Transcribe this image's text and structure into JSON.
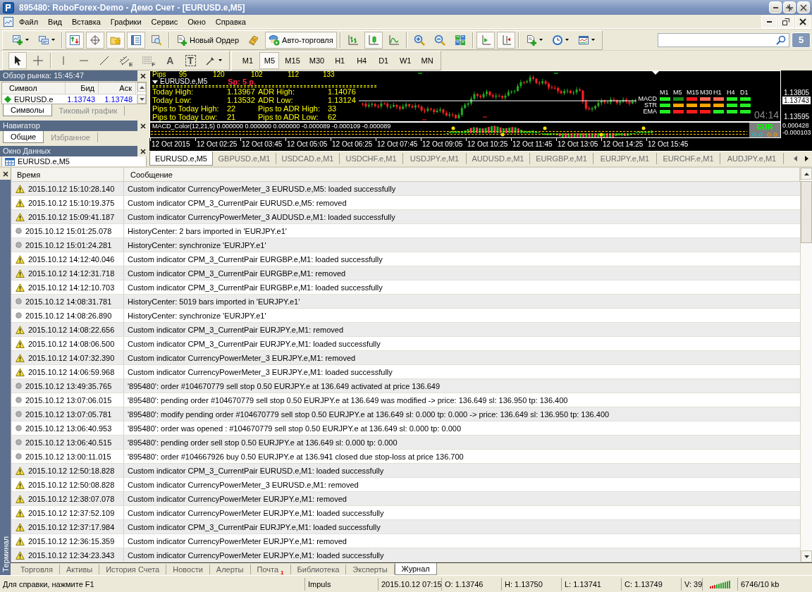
{
  "window": {
    "title": "895480: RoboForex-Demo - Демо Счет - [EURUSD.e,M5]"
  },
  "menu": [
    "Файл",
    "Вид",
    "Вставка",
    "Графики",
    "Сервис",
    "Окно",
    "Справка"
  ],
  "toolbar": {
    "groups": [
      {
        "items": [
          {
            "kind": "chart",
            "pressed": false
          },
          {
            "kind": "profiles",
            "pressed": false
          }
        ]
      },
      {
        "items": [
          {
            "kind": "watch",
            "pressed": true
          },
          {
            "kind": "data",
            "pressed": true
          },
          {
            "kind": "navigator",
            "pressed": true
          },
          {
            "kind": "terminal",
            "pressed": true
          },
          {
            "kind": "tester",
            "pressed": false
          }
        ]
      },
      {
        "items": [
          {
            "kind": "order",
            "label": "Новый Ордер",
            "pressed": false
          },
          {
            "kind": "editor",
            "pressed": false
          },
          {
            "kind": "autotrade",
            "label": "Авто-торговля",
            "pressed": true
          }
        ]
      },
      {
        "items": [
          {
            "kind": "bars",
            "pressed": false
          },
          {
            "kind": "candles",
            "pressed": true
          },
          {
            "kind": "line",
            "pressed": false
          }
        ]
      },
      {
        "items": [
          {
            "kind": "zoomin",
            "pressed": false
          },
          {
            "kind": "zoomout",
            "pressed": false
          },
          {
            "kind": "tile",
            "pressed": false
          }
        ]
      },
      {
        "items": [
          {
            "kind": "autoscroll",
            "pressed": true
          },
          {
            "kind": "shift",
            "pressed": true
          }
        ]
      },
      {
        "items": [
          {
            "kind": "indicators",
            "pressed": false
          },
          {
            "kind": "periods",
            "pressed": false
          },
          {
            "kind": "templates",
            "pressed": false
          }
        ]
      }
    ]
  },
  "messages_count": "5",
  "drawing_toolbar": {
    "groups": [
      {
        "items": [
          {
            "kind": "cursor",
            "pressed": true
          },
          {
            "kind": "crosshair",
            "pressed": false
          }
        ]
      },
      {
        "items": [
          {
            "kind": "vline",
            "pressed": false
          },
          {
            "kind": "hline",
            "pressed": false
          },
          {
            "kind": "trend",
            "pressed": false
          },
          {
            "kind": "channel",
            "glyph": "E",
            "pressed": false
          },
          {
            "kind": "fibo",
            "glyph": "F",
            "pressed": false
          },
          {
            "kind": "text",
            "glyph": "A",
            "pressed": false
          },
          {
            "kind": "label",
            "glyph": "T",
            "pressed": false
          },
          {
            "kind": "shapes",
            "pressed": false
          }
        ]
      }
    ]
  },
  "timeframes": [
    {
      "label": "M1",
      "selected": false
    },
    {
      "label": "M5",
      "selected": true
    },
    {
      "label": "M15",
      "selected": false
    },
    {
      "label": "M30",
      "selected": false
    },
    {
      "label": "H1",
      "selected": false
    },
    {
      "label": "H4",
      "selected": false
    },
    {
      "label": "D1",
      "selected": false
    },
    {
      "label": "W1",
      "selected": false
    },
    {
      "label": "MN",
      "selected": false
    }
  ],
  "market_watch": {
    "title": "Обзор рынка: 15:45:47",
    "columns": [
      "Символ",
      "Бид",
      "Аск"
    ],
    "rows": [
      {
        "symbol": "EURUSD.e",
        "bid": "1.13743",
        "ask": "1.13748"
      }
    ],
    "tabs": [
      {
        "label": "Символы",
        "selected": true
      },
      {
        "label": "Тиковый график",
        "selected": false
      }
    ]
  },
  "navigator": {
    "title": "Навигатор",
    "tabs": [
      {
        "label": "Общие",
        "selected": true
      },
      {
        "label": "Избранное",
        "selected": false
      }
    ]
  },
  "data_window": {
    "title": "Окно Данных",
    "rows": [
      {
        "label": "EURUSD.e,M5"
      }
    ]
  },
  "chart": {
    "symbol": "EURUSD.e,M5",
    "spread": "Sp: 5 p.",
    "pips": {
      "label": "Pips",
      "values": [
        "95",
        "120",
        "102",
        "112",
        "133"
      ]
    },
    "info_rows": [
      {
        "label": "Today High:",
        "value": "1.13967",
        "adr_label": "ADR High:",
        "adr_value": "1.14076"
      },
      {
        "label": "Today Low:",
        "value": "1.13532",
        "adr_label": "ADR Low:",
        "adr_value": "1.13124"
      },
      {
        "label": "Pips to Today High:",
        "value": "22",
        "adr_label": "Pips to ADR High:",
        "adr_value": "33"
      },
      {
        "label": "Pips to Today Low:",
        "value": "21",
        "adr_label": "Pips to ADR Low:",
        "adr_value": "62"
      }
    ],
    "cpm": {
      "columns": [
        "M1",
        "M5",
        "M15",
        "M30",
        "H1",
        "H4",
        "D1"
      ],
      "rows": [
        {
          "label": "MACD",
          "cells": [
            {
              "color": "#22ee22"
            },
            {
              "color": "#1a8a1a"
            },
            {
              "color": "#ff1a1a"
            },
            {
              "color": "#ff6a55"
            },
            {
              "color": "#ff6a55"
            },
            {
              "color": "#22ee22"
            },
            {
              "color": "#22ee22"
            }
          ]
        },
        {
          "label": "STR",
          "cells": [
            {
              "color": "#22ee22"
            },
            {
              "color": "#ffa500"
            },
            {
              "color": "#ffa500"
            },
            {
              "color": "#ffa500"
            },
            {
              "color": "#ffa500"
            },
            {
              "color": "#22ee22"
            },
            {
              "color": "#22ee22"
            }
          ]
        },
        {
          "label": "EMA",
          "cells": [
            {
              "color": "#22ee22"
            },
            {
              "color": "#ff1a1a"
            },
            {
              "color": "#ff1a1a"
            },
            {
              "color": "#ff1a1a"
            },
            {
              "color": "#22ee22"
            },
            {
              "color": "#22ee22"
            },
            {
              "color": "#22ee22"
            }
          ]
        }
      ]
    },
    "timer": "04:14",
    "price_labels": [
      {
        "text": "1.13805",
        "current": false
      },
      {
        "text": "1.13743",
        "current": true
      },
      {
        "text": "1.13595",
        "current": false
      }
    ],
    "macd": {
      "label": "MACD_Color(12,21,5) 0.000000 0.000000 0.000000 -0.000089 -0.000109 -0.000089",
      "scale": [
        "0.000428",
        "-0.000103"
      ],
      "currency": "EUR"
    },
    "time_labels": [
      "12 Oct 2015",
      "12 Oct 02:25",
      "12 Oct 03:45",
      "12 Oct 05:05",
      "12 Oct 06:25",
      "12 Oct 07:45",
      "12 Oct 09:05",
      "12 Oct 10:25",
      "12 Oct 11:45",
      "12 Oct 13:05",
      "12 Oct 14:25",
      "12 Oct 15:45"
    ]
  },
  "chart_tabs": [
    {
      "label": "EURUSD.e,M5",
      "selected": true
    },
    {
      "label": "GBPUSD.e,M1",
      "selected": false
    },
    {
      "label": "USDCAD.e,M1",
      "selected": false
    },
    {
      "label": "USDCHF.e,M1",
      "selected": false
    },
    {
      "label": "USDJPY.e,M1",
      "selected": false
    },
    {
      "label": "AUDUSD.e,M1",
      "selected": false
    },
    {
      "label": "EURGBP.e,M1",
      "selected": false
    },
    {
      "label": "EURJPY.e,M1",
      "selected": false
    },
    {
      "label": "EURCHF.e,M1",
      "selected": false
    },
    {
      "label": "AUDJPY.e,M1",
      "selected": false
    }
  ],
  "terminal": {
    "title": "Терминал",
    "columns": [
      "Время",
      "Сообщение"
    ],
    "rows": [
      {
        "kind": "warning",
        "time": "2015.10.12 15:10:28.140",
        "message": "Custom indicator CurrencyPowerMeter_3 EURUSD.e,M5: loaded successfully"
      },
      {
        "kind": "warning",
        "time": "2015.10.12 15:10:19.375",
        "message": "Custom indicator CPM_3_CurrentPair EURUSD.e,M5: removed"
      },
      {
        "kind": "warning",
        "time": "2015.10.12 15:09:41.187",
        "message": "Custom indicator CurrencyPowerMeter_3 AUDUSD.e,M1: loaded successfully"
      },
      {
        "kind": "info",
        "time": "2015.10.12 15:01:25.078",
        "message": "HistoryCenter: 2 bars imported in 'EURJPY.e1'"
      },
      {
        "kind": "info",
        "time": "2015.10.12 15:01:24.281",
        "message": "HistoryCenter: synchronize 'EURJPY.e1'"
      },
      {
        "kind": "warning",
        "time": "2015.10.12 14:12:40.046",
        "message": "Custom indicator CPM_3_CurrentPair EURGBP.e,M1: loaded successfully"
      },
      {
        "kind": "warning",
        "time": "2015.10.12 14:12:31.718",
        "message": "Custom indicator CPM_3_CurrentPair EURGBP.e,M1: removed"
      },
      {
        "kind": "warning",
        "time": "2015.10.12 14:12:10.703",
        "message": "Custom indicator CPM_3_CurrentPair EURGBP.e,M1: loaded successfully"
      },
      {
        "kind": "info",
        "time": "2015.10.12 14:08:31.781",
        "message": "HistoryCenter: 5019 bars imported in 'EURJPY.e1'"
      },
      {
        "kind": "info",
        "time": "2015.10.12 14:08:26.890",
        "message": "HistoryCenter: synchronize 'EURJPY.e1'"
      },
      {
        "kind": "warning",
        "time": "2015.10.12 14:08:22.656",
        "message": "Custom indicator CPM_3_CurrentPair EURJPY.e,M1: removed"
      },
      {
        "kind": "warning",
        "time": "2015.10.12 14:08:06.500",
        "message": "Custom indicator CPM_3_CurrentPair EURJPY.e,M1: loaded successfully"
      },
      {
        "kind": "warning",
        "time": "2015.10.12 14:07:32.390",
        "message": "Custom indicator CurrencyPowerMeter_3 EURJPY.e,M1: removed"
      },
      {
        "kind": "warning",
        "time": "2015.10.12 14:06:59.968",
        "message": "Custom indicator CurrencyPowerMeter_3 EURJPY.e,M1: loaded successfully"
      },
      {
        "kind": "info",
        "time": "2015.10.12 13:49:35.765",
        "message": "'895480': order #104670779 sell stop 0.50 EURJPY.e at 136.649 activated at price 136.649"
      },
      {
        "kind": "info",
        "time": "2015.10.12 13:07:06.015",
        "message": "'895480': pending order #104670779 sell stop 0.50 EURJPY.e at 136.649 was modified -> price: 136.649 sl: 136.950 tp: 136.400"
      },
      {
        "kind": "info",
        "time": "2015.10.12 13:07:05.781",
        "message": "'895480': modify pending order #104670779 sell stop 0.50 EURJPY.e at 136.649 sl: 0.000 tp: 0.000 -> price: 136.649 sl: 136.950 tp: 136.400"
      },
      {
        "kind": "info",
        "time": "2015.10.12 13:06:40.953",
        "message": "'895480': order was opened : #104670779 sell stop 0.50 EURJPY.e at 136.649 sl: 0.000 tp: 0.000"
      },
      {
        "kind": "info",
        "time": "2015.10.12 13:06:40.515",
        "message": "'895480': pending order sell stop 0.50 EURJPY.e at 136.649 sl: 0.000 tp: 0.000"
      },
      {
        "kind": "info",
        "time": "2015.10.12 13:00:11.015",
        "message": "'895480': order #104667926 buy 0.50 EURJPY.e at 136.941 closed due stop-loss at price 136.700"
      },
      {
        "kind": "warning",
        "time": "2015.10.12 12:50:18.828",
        "message": "Custom indicator CPM_3_CurrentPair EURUSD.e,M1: loaded successfully"
      },
      {
        "kind": "warning",
        "time": "2015.10.12 12:50:08.828",
        "message": "Custom indicator CurrencyPowerMeter_3 EURUSD.e,M1: removed"
      },
      {
        "kind": "warning",
        "time": "2015.10.12 12:38:07.078",
        "message": "Custom indicator CurrencyPowerMeter EURJPY.e,M1: removed"
      },
      {
        "kind": "warning",
        "time": "2015.10.12 12:37:52.109",
        "message": "Custom indicator CurrencyPowerMeter EURJPY.e,M1: loaded successfully"
      },
      {
        "kind": "warning",
        "time": "2015.10.12 12:37:17.984",
        "message": "Custom indicator CPM_3_CurrentPair EURJPY.e,M1: loaded successfully"
      },
      {
        "kind": "warning",
        "time": "2015.10.12 12:36:15.359",
        "message": "Custom indicator CurrencyPowerMeter EURJPY.e,M1: removed"
      },
      {
        "kind": "warning",
        "time": "2015.10.12 12:34:23.343",
        "message": "Custom indicator CurrencyPowerMeter EURJPY.e,M1: loaded successfully"
      }
    ],
    "tabs": [
      {
        "label": "Торговля",
        "selected": false
      },
      {
        "label": "Активы",
        "selected": false
      },
      {
        "label": "История Счета",
        "selected": false
      },
      {
        "label": "Новости",
        "selected": false
      },
      {
        "label": "Алерты",
        "selected": false
      },
      {
        "label": "Почта",
        "badge": "1",
        "selected": false
      },
      {
        "label": "Библиотека",
        "selected": false
      },
      {
        "label": "Эксперты",
        "selected": false
      },
      {
        "label": "Журнал",
        "selected": true
      }
    ]
  },
  "status_bar": {
    "help": "Для справки, нажмите F1",
    "profile": "Impuls",
    "time": "2015.10.12 07:15",
    "open": "O: 1.13746",
    "high": "H: 1.13750",
    "low": "L: 1.13741",
    "close": "C: 1.13749",
    "volume": "V: 39",
    "traffic": "6746/10 kb"
  }
}
